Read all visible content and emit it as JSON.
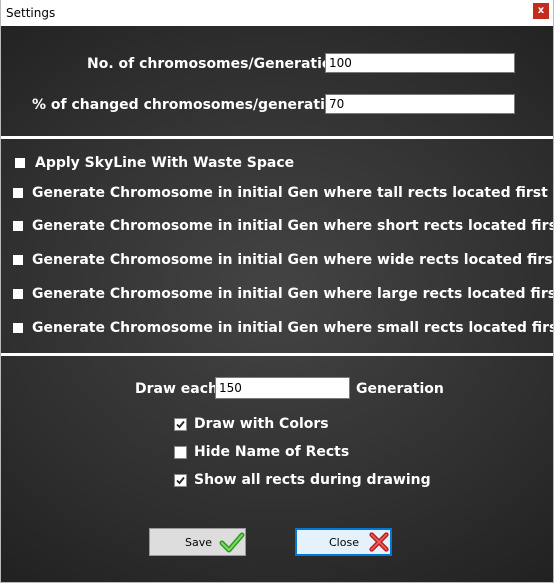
{
  "window": {
    "title": "Settings",
    "close_glyph": "x"
  },
  "params": {
    "chromosomes_label": "No. of chromosomes/Generation",
    "chromosomes_value": "100",
    "changed_label": "% of changed chromosomes/generation",
    "changed_value": "70"
  },
  "options": {
    "skyline": "Apply SkyLine With Waste Space",
    "tall": "Generate Chromosome in initial Gen where tall rects located first",
    "short": "Generate Chromosome in initial Gen where short rects located first",
    "wide": "Generate Chromosome in initial Gen where wide rects located first",
    "large": "Generate Chromosome in initial Gen where large rects located first",
    "small": "Generate Chromosome in initial Gen where small rects located first"
  },
  "drawing": {
    "draw_each_label": "Draw each",
    "draw_each_value": "150",
    "generation_label": "Generation",
    "draw_colors_label": "Draw with Colors",
    "draw_colors_checked": true,
    "hide_names_label": "Hide Name of Rects",
    "hide_names_checked": false,
    "show_all_label": "Show all rects during drawing",
    "show_all_checked": true
  },
  "buttons": {
    "save_label": "Save",
    "save_icon": "green-checkmark-icon",
    "close_label": "Close",
    "close_icon": "red-x-icon"
  },
  "colors": {
    "background": "#2f2f2f",
    "text": "#ffffff",
    "accent": "#0078d7",
    "close_red": "#c42b1c"
  }
}
